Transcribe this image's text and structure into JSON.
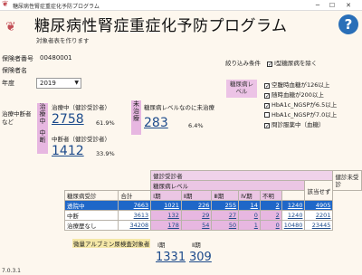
{
  "window": {
    "title": "糖尿病性腎症重症化予防プログラム"
  },
  "header": {
    "title": "糖尿病性腎症重症化予防プログラム",
    "subtitle": "対象者表を作ります",
    "help_label": "?"
  },
  "insurer": {
    "number_label": "保険者番号",
    "number_value": "00480001",
    "name_label": "保険者名",
    "year_label": "年度",
    "year_value": "2019"
  },
  "filters": {
    "section_label": "絞り込み条件",
    "dm1_exclude": {
      "label": "Ⅰ型糖尿病を除く",
      "checked": true
    },
    "level_label": "糖尿病レベル",
    "options": [
      {
        "label": "空腹時血糖が126以上",
        "checked": true
      },
      {
        "label": "随時血糖が200以上",
        "checked": true
      },
      {
        "label": "HbA1c_NGSPが6.5以上",
        "checked": true
      },
      {
        "label": "HbA1c_NGSPが7.0以上",
        "checked": false
      },
      {
        "label": "問診服薬中（血糖）",
        "checked": true
      }
    ]
  },
  "stats": {
    "dropout_label": "治療中断者など",
    "treating_tag": "治療中",
    "interrupted_tag": "中断",
    "untreated_tag": "未治療",
    "treating_label": "治療中（健診受診者）",
    "treating_value": "2758",
    "treating_pct": "61.9%",
    "interrupted_label": "中断者（健診受診者）",
    "interrupted_value": "1412",
    "interrupted_pct": "33.9%",
    "untreated_label": "糖尿病レベルなのに未治療",
    "untreated_value": "283",
    "untreated_pct": "6.4%"
  },
  "table": {
    "group_header": "健診受診者",
    "level_header": "糖尿病レベル",
    "nonexam_header": "健診未受診",
    "row_header": "糖尿病受診",
    "columns": [
      "合計",
      "Ⅰ期",
      "Ⅱ期",
      "Ⅲ期",
      "Ⅳ期",
      "不明",
      "該当せず"
    ],
    "rows": [
      {
        "label": "透院中",
        "values": [
          "7663",
          "1021",
          "226",
          "255",
          "14",
          "2",
          "1240",
          "4905"
        ]
      },
      {
        "label": "中断",
        "values": [
          "3613",
          "132",
          "29",
          "27",
          "0",
          "2",
          "1240",
          "2201"
        ]
      },
      {
        "label": "治療歴なし",
        "values": [
          "34208",
          "178",
          "54",
          "50",
          "1",
          "0",
          "10480",
          "23445"
        ]
      }
    ]
  },
  "albumin": {
    "label": "微量アルブミン尿検査対象者",
    "stage1_label": "Ⅰ期",
    "stage2_label": "Ⅱ期",
    "stage1_value": "1331",
    "stage2_value": "309"
  },
  "footer": {
    "version": "7.0.3.1"
  }
}
